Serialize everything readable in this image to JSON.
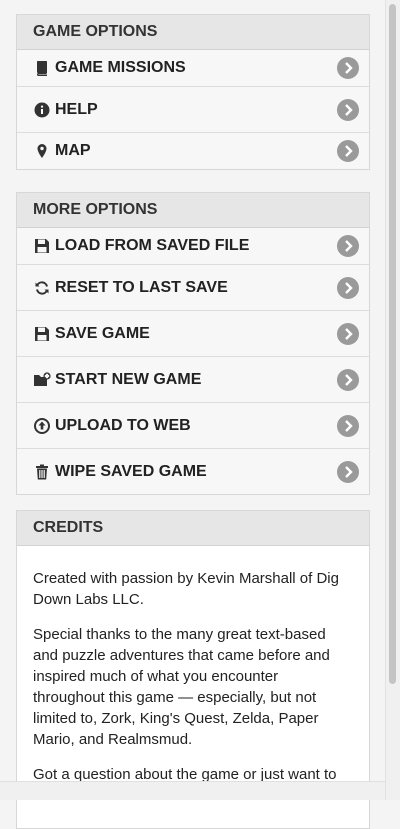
{
  "game_options": {
    "title": "GAME OPTIONS",
    "items": [
      {
        "label": "GAME MISSIONS",
        "icon": "book-icon"
      },
      {
        "label": "HELP",
        "icon": "info-icon"
      },
      {
        "label": "MAP",
        "icon": "map-pin-icon"
      }
    ]
  },
  "more_options": {
    "title": "MORE OPTIONS",
    "items": [
      {
        "label": "LOAD FROM SAVED FILE",
        "icon": "floppy-icon"
      },
      {
        "label": "RESET TO LAST SAVE",
        "icon": "refresh-icon"
      },
      {
        "label": "SAVE GAME",
        "icon": "floppy-icon"
      },
      {
        "label": "START NEW GAME",
        "icon": "folder-plus-icon"
      },
      {
        "label": "UPLOAD TO WEB",
        "icon": "upload-circle-icon"
      },
      {
        "label": "WIPE SAVED GAME",
        "icon": "trash-icon"
      }
    ]
  },
  "credits": {
    "title": "CREDITS",
    "paragraphs": [
      "Created with passion by Kevin Marshall of Dig Down Labs LLC.",
      "Special thanks to the many great text-based and puzzle adventures that came before and inspired much of what you encounter throughout this game — especially, but not limited to, Zork, King's Quest, Zelda, Paper Mario, and Realmsmud.",
      "Got a question about the game or just want to"
    ]
  },
  "colors": {
    "chevron_bg": "#9a9a9a",
    "header_bg": "#e6e6e6",
    "icon": "#333333"
  }
}
